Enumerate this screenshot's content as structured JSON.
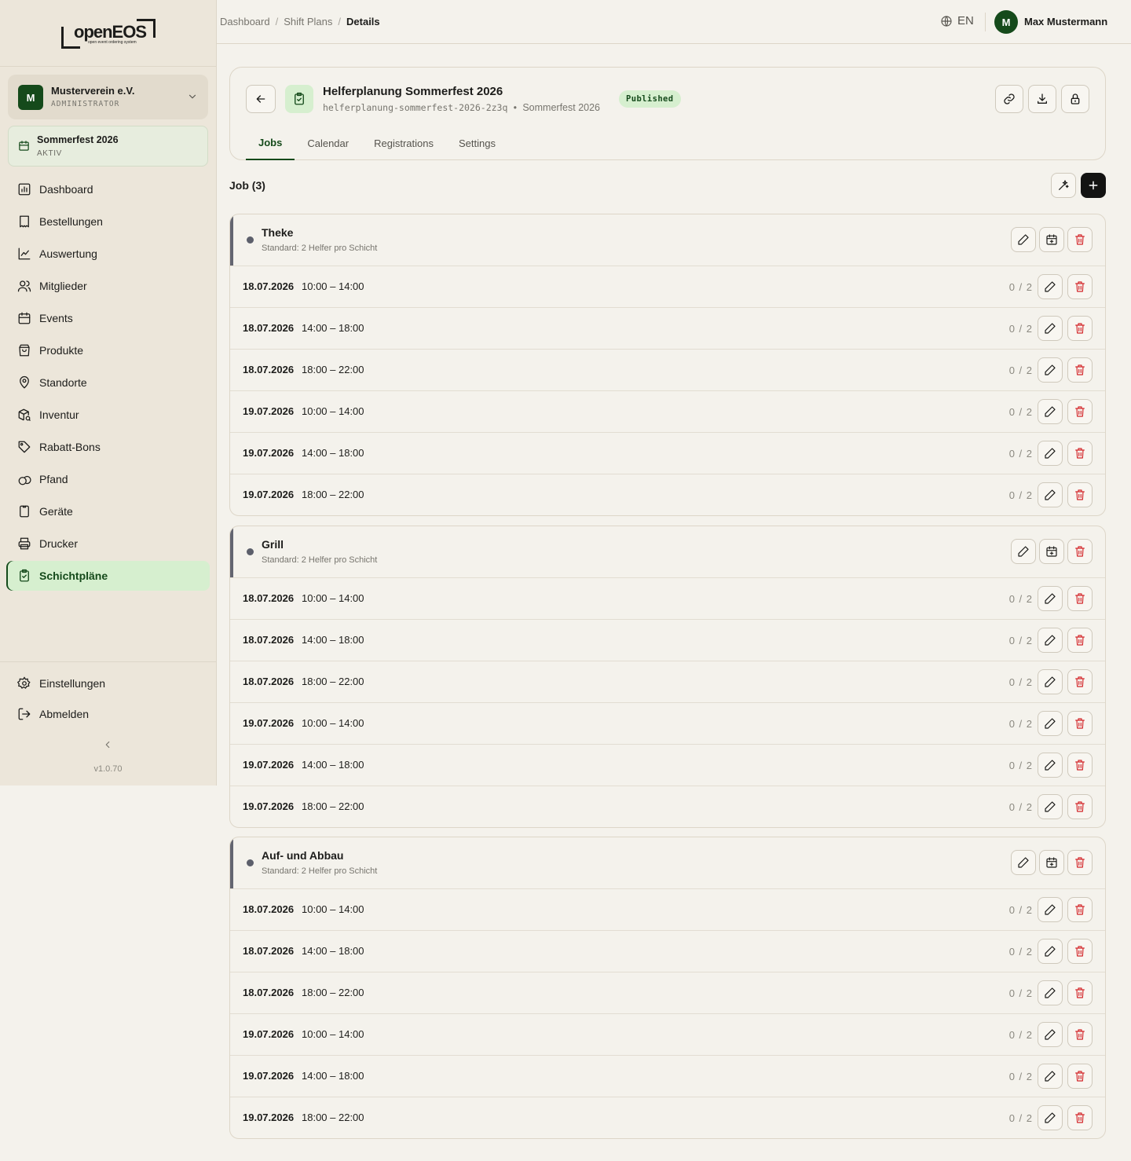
{
  "logo": {
    "text": "openEOS",
    "subtitle": "open event ordering system"
  },
  "org": {
    "avatar": "M",
    "name": "Musterverein e.V.",
    "role": "ADMINISTRATOR"
  },
  "event": {
    "name": "Sommerfest 2026",
    "status": "AKTIV"
  },
  "nav": [
    {
      "label": "Dashboard",
      "icon": "dashboard-icon"
    },
    {
      "label": "Bestellungen",
      "icon": "orders-icon"
    },
    {
      "label": "Auswertung",
      "icon": "chart-icon"
    },
    {
      "label": "Mitglieder",
      "icon": "members-icon"
    },
    {
      "label": "Events",
      "icon": "calendar-icon"
    },
    {
      "label": "Produkte",
      "icon": "bag-icon"
    },
    {
      "label": "Standorte",
      "icon": "location-icon"
    },
    {
      "label": "Inventur",
      "icon": "inventory-icon"
    },
    {
      "label": "Rabatt-Bons",
      "icon": "tag-icon"
    },
    {
      "label": "Pfand",
      "icon": "deposit-icon"
    },
    {
      "label": "Geräte",
      "icon": "device-icon"
    },
    {
      "label": "Drucker",
      "icon": "printer-icon"
    },
    {
      "label": "Schichtpläne",
      "icon": "clipboard-icon",
      "active": true
    }
  ],
  "sidebar_bottom": {
    "settings": "Einstellungen",
    "logout": "Abmelden",
    "version": "v1.0.70"
  },
  "breadcrumb": {
    "first": "Dashboard",
    "second": "Shift Plans",
    "current": "Details"
  },
  "topbar": {
    "language": "EN",
    "user_avatar": "M",
    "user_name": "Max Mustermann"
  },
  "plan": {
    "title": "Helferplanung Sommerfest 2026",
    "slug": "helferplanung-sommerfest-2026-2z3q",
    "event": "Sommerfest 2026",
    "status": "Published"
  },
  "tabs": [
    "Jobs",
    "Calendar",
    "Registrations",
    "Settings"
  ],
  "job_count": "Job (3)",
  "jobs": [
    {
      "name": "Theke",
      "subtitle": "Standard: 2 Helfer pro Schicht"
    },
    {
      "name": "Grill",
      "subtitle": "Standard: 2 Helfer pro Schicht"
    },
    {
      "name": "Auf- und Abbau",
      "subtitle": "Standard: 2 Helfer pro Schicht"
    }
  ],
  "shifts": [
    {
      "date": "18.07.2026",
      "time": "10:00 – 14:00",
      "count": "0 / 2"
    },
    {
      "date": "18.07.2026",
      "time": "14:00 – 18:00",
      "count": "0 / 2"
    },
    {
      "date": "18.07.2026",
      "time": "18:00 – 22:00",
      "count": "0 / 2"
    },
    {
      "date": "19.07.2026",
      "time": "10:00 – 14:00",
      "count": "0 / 2"
    },
    {
      "date": "19.07.2026",
      "time": "14:00 – 18:00",
      "count": "0 / 2"
    },
    {
      "date": "19.07.2026",
      "time": "18:00 – 22:00",
      "count": "0 / 2"
    }
  ],
  "colors": {
    "accent": "#154a1b",
    "accent_soft": "#d6efcf",
    "danger": "#d3272b",
    "sidebar_bg": "#ece6da",
    "page_bg": "#f4f2ec"
  }
}
